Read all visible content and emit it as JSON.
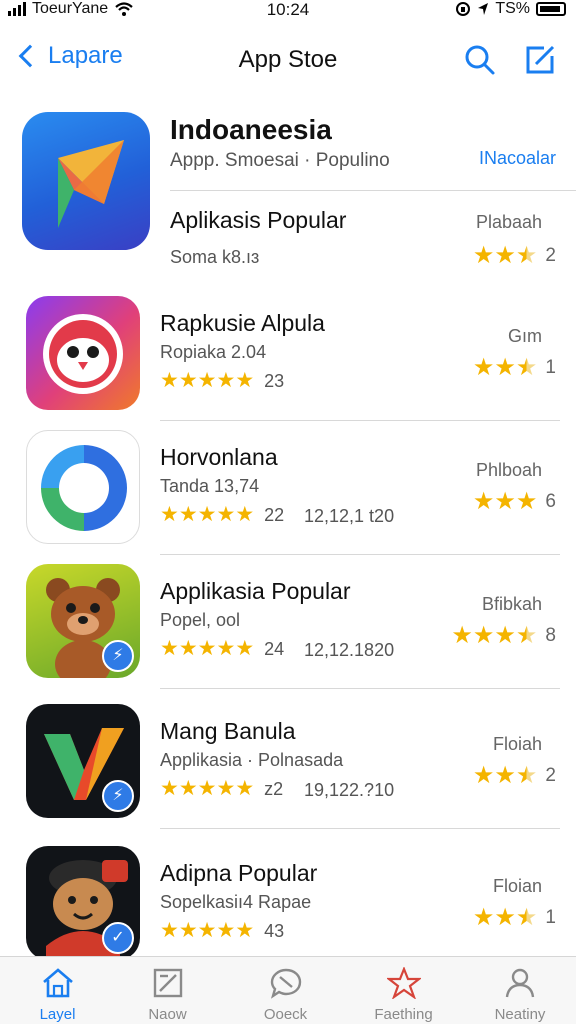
{
  "status_bar": {
    "carrier": "ToeurYane",
    "time": "10:24",
    "battery": "TS%"
  },
  "nav": {
    "back_label": "Lapare",
    "title": "App Stoe"
  },
  "featured": {
    "title": "Indoaneesia",
    "subtitle": "Appp. Smoesai · Populino",
    "right_label": "INacoalar",
    "title2": "Aplikasis Popular",
    "meta": "Soma k8.ıɜ",
    "status": "Plabaah",
    "rating": {
      "filled": 2.5,
      "value": "2"
    }
  },
  "apps": [
    {
      "title": "Rapkusie Alpula",
      "subtitle": "Ropiaka 2.04",
      "stars": 5,
      "count": "23",
      "extra": "",
      "status": "Gım",
      "rating_filled": 2.5,
      "rating_value": "1"
    },
    {
      "title": "Horvonlana",
      "subtitle": "Tanda 13,74",
      "stars": 5,
      "count": "22",
      "extra": "12,12,1 t20",
      "status": "Phlboah",
      "rating_filled": 3,
      "rating_value": "6"
    },
    {
      "title": "Applikasia Popular",
      "subtitle": "Popel, ool",
      "stars": 5,
      "count": "24",
      "extra": "12,12.1820",
      "status": "Bfibkah",
      "rating_filled": 3.5,
      "rating_value": "8"
    },
    {
      "title": "Mang Banula",
      "subtitle": "Applikasia · Polnasada",
      "stars": 5,
      "count": "z2",
      "extra": "19,122.?10",
      "status": "Floiah",
      "rating_filled": 2.5,
      "rating_value": "2"
    },
    {
      "title": "Adipna Popular",
      "subtitle": "Sopelkasiı4 Rapae",
      "stars": 5,
      "count": "43",
      "extra": "",
      "status": "Floian",
      "rating_filled": 2.5,
      "rating_value": "1"
    }
  ],
  "tabs": [
    {
      "label": "Layel",
      "icon": "home-icon",
      "active": true
    },
    {
      "label": "Naow",
      "icon": "news-icon",
      "active": false
    },
    {
      "label": "Ooeck",
      "icon": "chat-icon",
      "active": false
    },
    {
      "label": "Faething",
      "icon": "star-icon",
      "active": false
    },
    {
      "label": "Neatiny",
      "icon": "person-icon",
      "active": false
    }
  ],
  "colors": {
    "accent": "#1a7ef0",
    "star": "#f4b400",
    "featured_icon": "#2a6ee0"
  }
}
